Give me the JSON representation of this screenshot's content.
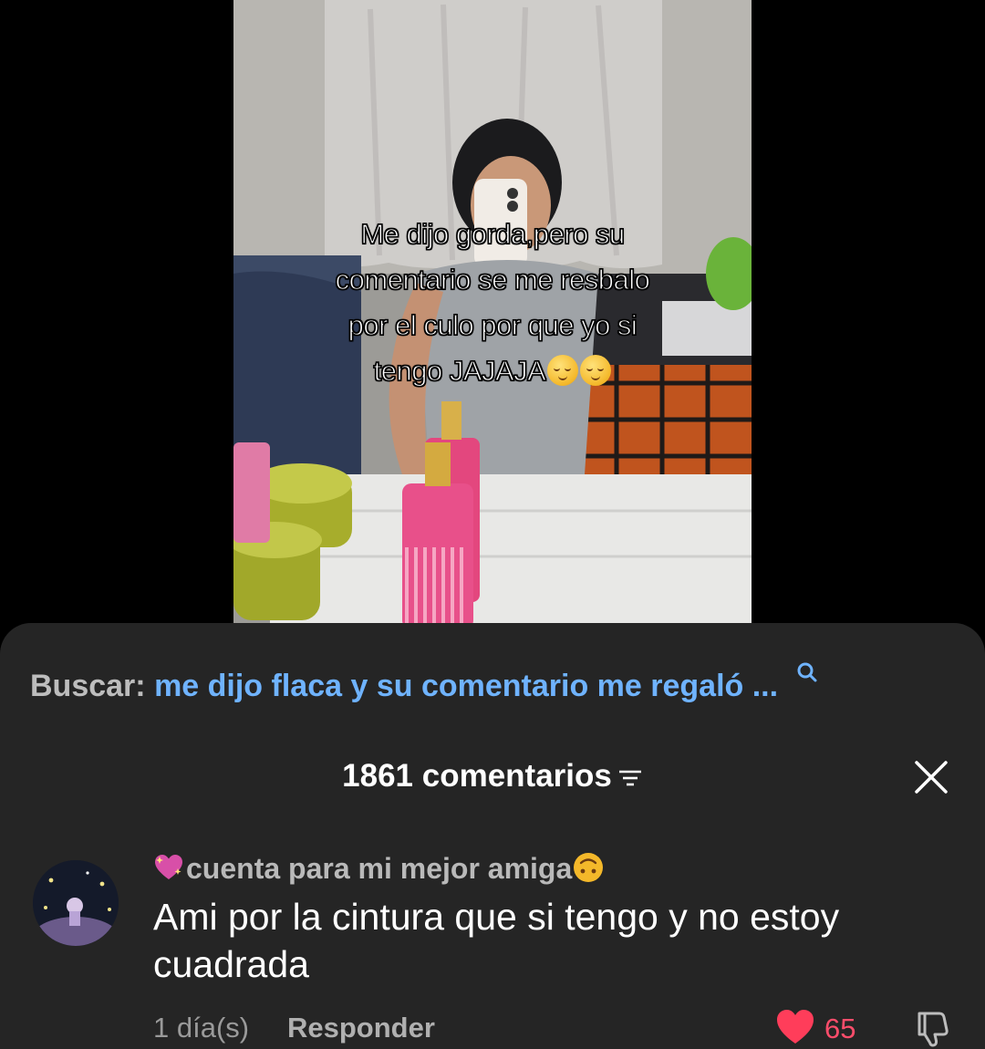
{
  "video": {
    "caption_lines": [
      "Me dijo gorda,pero su",
      "comentario se me resbalo",
      "por el culo por que yo si",
      "tengo JAJAJA"
    ]
  },
  "search": {
    "label": "Buscar:",
    "query": "me dijo flaca y su comentario me regaló ...",
    "icon": "search-icon"
  },
  "comments_panel": {
    "count_label": "1861 comentarios",
    "sort_icon": "sort-filter-icon",
    "close_icon": "close-icon"
  },
  "comment": {
    "username": "cuenta para mi mejor amiga",
    "text": "Ami por la cintura que si tengo y no estoy cuadrada",
    "timestamp": "1 día(s)",
    "reply_label": "Responder",
    "likes": "65",
    "liked": true
  },
  "colors": {
    "sheet_bg": "#252525",
    "accent_link": "#6fb3ff",
    "like_red": "#ff3d5a"
  }
}
